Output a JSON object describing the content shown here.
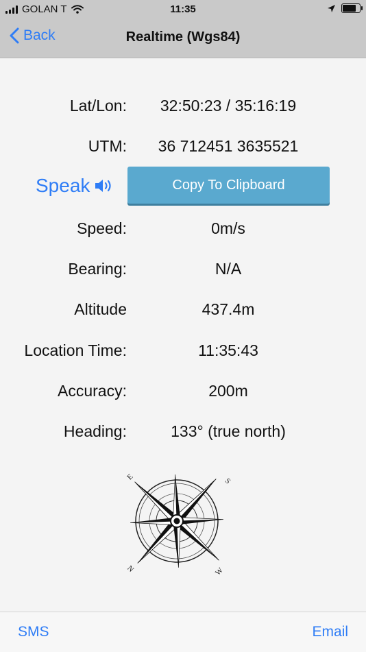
{
  "status_bar": {
    "carrier": "GOLAN T",
    "time": "11:35",
    "battery_level": 0.9
  },
  "nav": {
    "back_label": "Back",
    "title": "Realtime (Wgs84)"
  },
  "location": {
    "latlon_label": "Lat/Lon:",
    "latlon_value": "32:50:23 / 35:16:19",
    "utm_label": "UTM:",
    "utm_value": "36  712451 3635521",
    "speak_label": "Speak",
    "copy_label": "Copy To Clipboard",
    "speed_label": "Speed:",
    "speed_value": "0m/s",
    "bearing_label": "Bearing:",
    "bearing_value": "N/A",
    "altitude_label": "Altitude",
    "altitude_value": "437.4m",
    "location_time_label": "Location Time:",
    "location_time_value": "11:35:43",
    "accuracy_label": "Accuracy:",
    "accuracy_value": "200m",
    "heading_label": "Heading:",
    "heading_value": "133° (true north)"
  },
  "compass": {
    "letter_n": "N",
    "letter_s": "S",
    "letter_e": "E",
    "letter_w": "W",
    "rotation_deg": 133
  },
  "toolbar": {
    "sms_label": "SMS",
    "email_label": "Email"
  },
  "colors": {
    "accent": "#2f7df6",
    "copy_button": "#5aa9cf",
    "bar_background": "#c9c9c9"
  },
  "icons": [
    "signal-icon",
    "wifi-icon",
    "location-arrow-icon",
    "battery-icon",
    "chevron-left-icon",
    "speaker-icon",
    "compass-rose-icon"
  ]
}
